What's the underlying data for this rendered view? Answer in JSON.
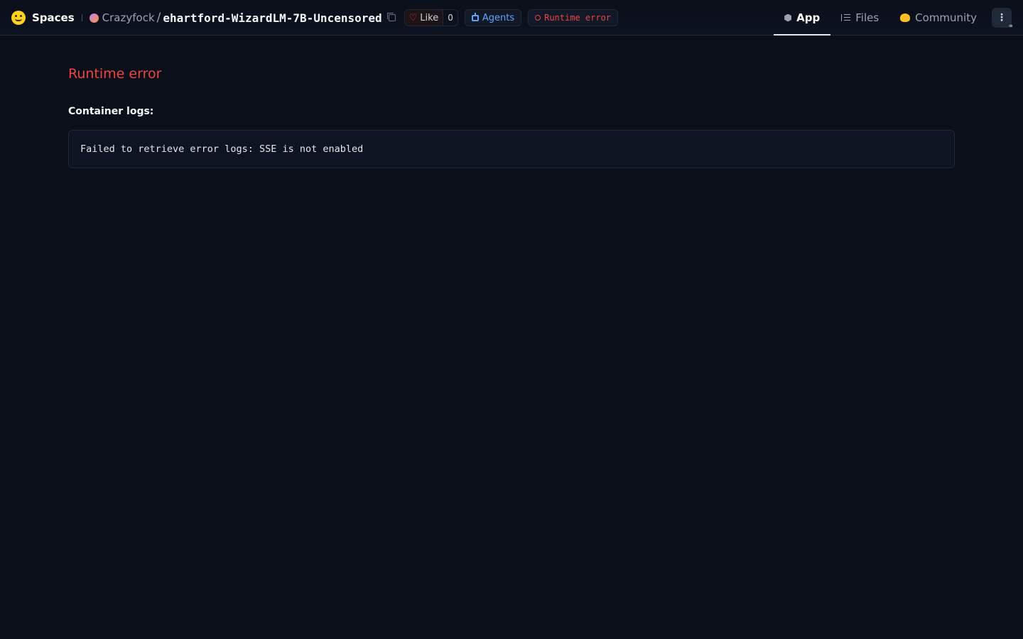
{
  "header": {
    "brand": "Spaces",
    "owner": "Crazyfock",
    "separator": "/",
    "repo": "ehartford-WizardLM-7B-Uncensored",
    "like_label": "Like",
    "like_count": "0",
    "agents_label": "Agents",
    "status_label": "Runtime error"
  },
  "tabs": [
    {
      "label": "App",
      "icon": "cube-icon"
    },
    {
      "label": "Files",
      "icon": "files-icon"
    },
    {
      "label": "Community",
      "icon": "community-icon"
    }
  ],
  "menu_glyph": "⋮",
  "main": {
    "error_title": "Runtime error",
    "logs_label": "Container logs:",
    "log_text": "Failed to retrieve error logs: SSE is not enabled"
  },
  "colors": {
    "background": "#0b0f19",
    "error": "#ef4444",
    "agents": "#60a5fa"
  }
}
